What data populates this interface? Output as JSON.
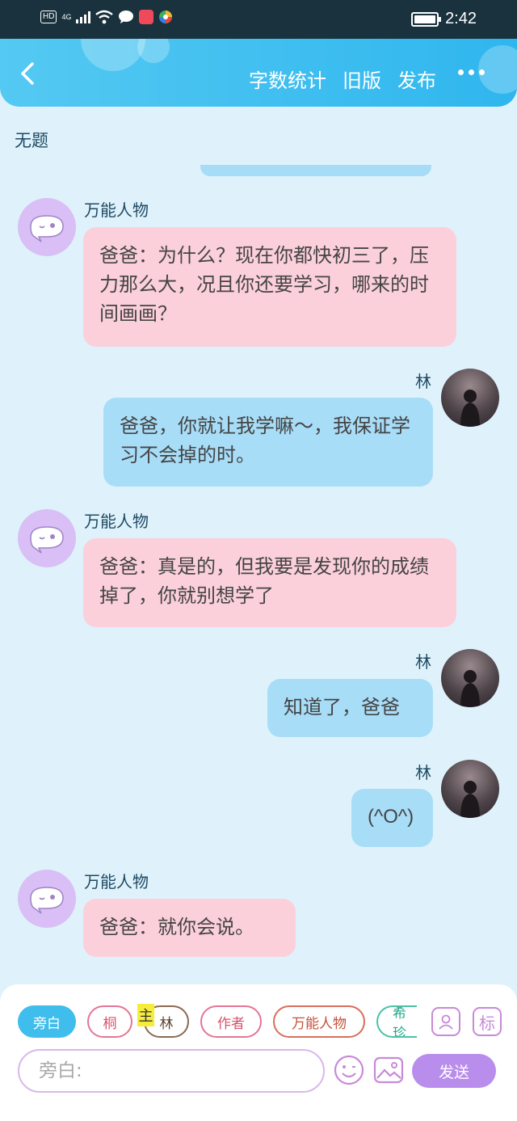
{
  "status_bar": {
    "hd": "HD",
    "network": "4G",
    "time": "2:42"
  },
  "header": {
    "actions": [
      "字数统计",
      "旧版",
      "发布"
    ]
  },
  "page_title": "无题",
  "messages": [
    {
      "sender": "万能人物",
      "side": "left",
      "text": "爸爸：为什么？现在你都快初三了，压力那么大，况且你还要学习，哪来的时间画画？"
    },
    {
      "sender": "林",
      "side": "right",
      "text": "爸爸，你就让我学嘛～，我保证学习不会掉的时。"
    },
    {
      "sender": "万能人物",
      "side": "left",
      "text": "爸爸：真是的，但我要是发现你的成绩掉了，你就别想学了"
    },
    {
      "sender": "林",
      "side": "right",
      "text": "知道了，爸爸"
    },
    {
      "sender": "林",
      "side": "right",
      "text": "(^O^)"
    },
    {
      "sender": "万能人物",
      "side": "left",
      "text": "爸爸：就你会说。"
    }
  ],
  "roles": {
    "chips": [
      "旁白",
      "桐",
      "林",
      "作者",
      "万能人物",
      "希珍"
    ],
    "owner_tag": "主",
    "tag_button": "标"
  },
  "composer": {
    "placeholder": "旁白:",
    "send_label": "发送"
  },
  "colors": {
    "header": "#2fb6ee",
    "npc_bubble": "#fbd0db",
    "my_bubble": "#a8ddf8",
    "send": "#b98deb"
  }
}
